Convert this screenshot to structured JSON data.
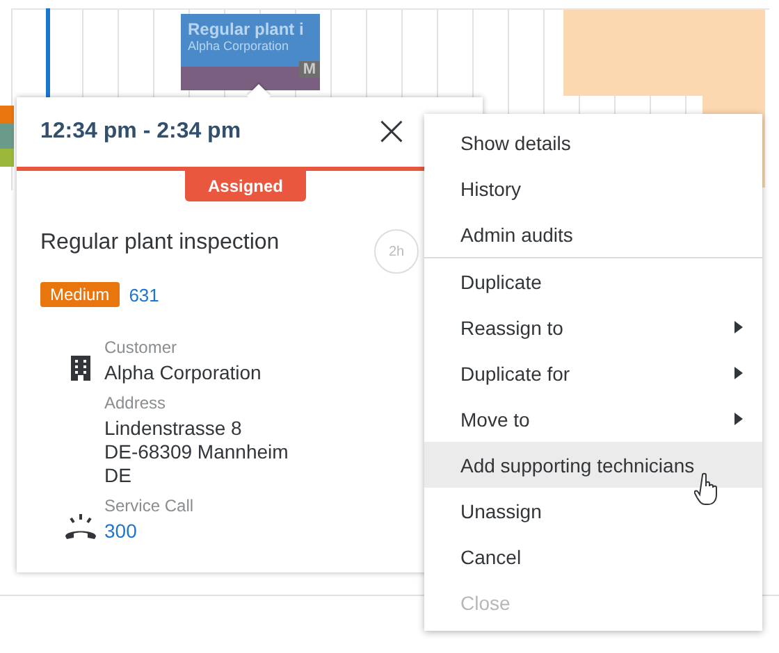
{
  "event": {
    "title": "Regular plant i",
    "customer": "Alpha Corporation",
    "badge": "M"
  },
  "popover": {
    "time": "12:34 pm - 2:34 pm",
    "close": "×",
    "status": "Assigned",
    "title": "Regular plant inspection",
    "duration": "2h",
    "priority": "Medium",
    "number": "631",
    "fields": [
      {
        "kind": "customer",
        "label": "Customer",
        "lines": [
          "Alpha Corporation"
        ],
        "link": false
      },
      {
        "kind": "address",
        "label": "Address",
        "lines": [
          "Lindenstrasse 8",
          "DE-68309 Mannheim",
          "DE"
        ],
        "link": false
      },
      {
        "kind": "service_call",
        "label": "Service Call",
        "lines": [
          "300"
        ],
        "link": true
      }
    ]
  },
  "menu": {
    "groups": [
      [
        {
          "label": "Show details",
          "submenu": false,
          "highlighted": false,
          "disabled": false
        },
        {
          "label": "History",
          "submenu": false,
          "highlighted": false,
          "disabled": false
        },
        {
          "label": "Admin audits",
          "submenu": false,
          "highlighted": false,
          "disabled": false
        }
      ],
      [
        {
          "label": "Duplicate",
          "submenu": false,
          "highlighted": false,
          "disabled": false
        },
        {
          "label": "Reassign to",
          "submenu": true,
          "highlighted": false,
          "disabled": false
        },
        {
          "label": "Duplicate for",
          "submenu": true,
          "highlighted": false,
          "disabled": false
        },
        {
          "label": "Move to",
          "submenu": true,
          "highlighted": false,
          "disabled": false
        },
        {
          "label": "Add supporting technicians",
          "submenu": false,
          "highlighted": true,
          "disabled": false
        },
        {
          "label": "Unassign",
          "submenu": false,
          "highlighted": false,
          "disabled": false
        },
        {
          "label": "Cancel",
          "submenu": false,
          "highlighted": false,
          "disabled": false
        },
        {
          "label": "Close",
          "submenu": false,
          "highlighted": false,
          "disabled": true
        }
      ]
    ]
  }
}
